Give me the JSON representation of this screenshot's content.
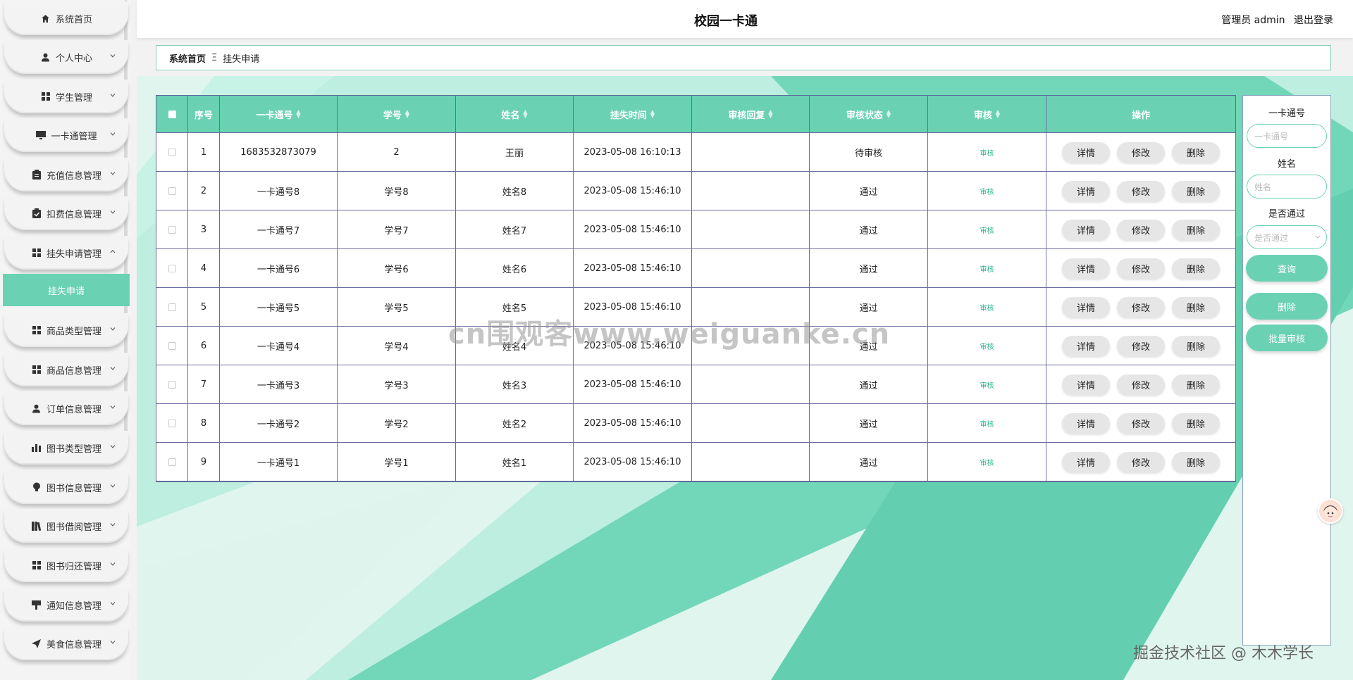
{
  "app": {
    "title": "校园一卡通"
  },
  "header": {
    "user_label": "管理员 admin",
    "logout": "退出登录"
  },
  "sidebar": {
    "items": [
      {
        "label": "系统首页",
        "icon": "home-icon",
        "expandable": false
      },
      {
        "label": "个人中心",
        "icon": "user-icon",
        "expandable": true
      },
      {
        "label": "学生管理",
        "icon": "grid-icon",
        "expandable": true
      },
      {
        "label": "一卡通管理",
        "icon": "monitor-icon",
        "expandable": true
      },
      {
        "label": "充值信息管理",
        "icon": "clipboard-icon",
        "expandable": true
      },
      {
        "label": "扣费信息管理",
        "icon": "clipboard-check-icon",
        "expandable": true
      },
      {
        "label": "挂失申请管理",
        "icon": "grid-icon",
        "expandable": true,
        "expanded": true
      },
      {
        "label": "商品类型管理",
        "icon": "grid-icon",
        "expandable": true
      },
      {
        "label": "商品信息管理",
        "icon": "grid-icon",
        "expandable": true
      },
      {
        "label": "订单信息管理",
        "icon": "user-icon",
        "expandable": true
      },
      {
        "label": "图书类型管理",
        "icon": "bar-chart-icon",
        "expandable": true
      },
      {
        "label": "图书信息管理",
        "icon": "bulb-icon",
        "expandable": true
      },
      {
        "label": "图书借阅管理",
        "icon": "book-icon",
        "expandable": true
      },
      {
        "label": "图书归还管理",
        "icon": "grid-icon",
        "expandable": true
      },
      {
        "label": "通知信息管理",
        "icon": "bell-icon",
        "expandable": true
      },
      {
        "label": "美食信息管理",
        "icon": "send-icon",
        "expandable": true
      }
    ],
    "active_sub": "挂失申请"
  },
  "breadcrumb": {
    "home": "系统首页",
    "separator": "Ξ",
    "current": "挂失申请"
  },
  "table": {
    "columns": [
      "序号",
      "一卡通号",
      "学号",
      "姓名",
      "挂失时间",
      "审核回复",
      "审核状态",
      "审核",
      "操作"
    ],
    "audit_label": "审核",
    "actions": [
      "详情",
      "修改",
      "删除"
    ],
    "rows": [
      {
        "idx": "1",
        "card": "1683532873079",
        "student_no": "2",
        "name": "王丽",
        "time": "2023-05-08 16:10:13",
        "reply": "",
        "status": "待审核"
      },
      {
        "idx": "2",
        "card": "一卡通号8",
        "student_no": "学号8",
        "name": "姓名8",
        "time": "2023-05-08 15:46:10",
        "reply": "",
        "status": "通过"
      },
      {
        "idx": "3",
        "card": "一卡通号7",
        "student_no": "学号7",
        "name": "姓名7",
        "time": "2023-05-08 15:46:10",
        "reply": "",
        "status": "通过"
      },
      {
        "idx": "4",
        "card": "一卡通号6",
        "student_no": "学号6",
        "name": "姓名6",
        "time": "2023-05-08 15:46:10",
        "reply": "",
        "status": "通过"
      },
      {
        "idx": "5",
        "card": "一卡通号5",
        "student_no": "学号5",
        "name": "姓名5",
        "time": "2023-05-08 15:46:10",
        "reply": "",
        "status": "通过"
      },
      {
        "idx": "6",
        "card": "一卡通号4",
        "student_no": "学号4",
        "name": "姓名4",
        "time": "2023-05-08 15:46:10",
        "reply": "",
        "status": "通过"
      },
      {
        "idx": "7",
        "card": "一卡通号3",
        "student_no": "学号3",
        "name": "姓名3",
        "time": "2023-05-08 15:46:10",
        "reply": "",
        "status": "通过"
      },
      {
        "idx": "8",
        "card": "一卡通号2",
        "student_no": "学号2",
        "name": "姓名2",
        "time": "2023-05-08 15:46:10",
        "reply": "",
        "status": "通过"
      },
      {
        "idx": "9",
        "card": "一卡通号1",
        "student_no": "学号1",
        "name": "姓名1",
        "time": "2023-05-08 15:46:10",
        "reply": "",
        "status": "通过"
      }
    ]
  },
  "search": {
    "card_label": "一卡通号",
    "card_placeholder": "一卡通号",
    "name_label": "姓名",
    "name_placeholder": "姓名",
    "pass_label": "是否通过",
    "pass_placeholder": "是否通过",
    "query_button": "查询",
    "delete_button": "删除",
    "batch_audit_button": "批量审核"
  },
  "overlays": {
    "watermark": "cn围观客www.weiguanke.cn",
    "credit": "掘金技术社区 @ 木木学长"
  },
  "colors": {
    "accent": "#6bd1b3",
    "audit_link": "#2bb58d"
  }
}
